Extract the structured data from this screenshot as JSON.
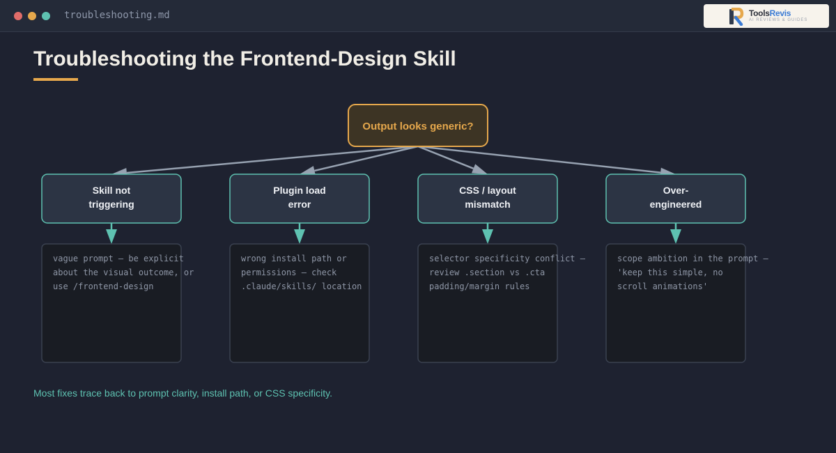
{
  "window": {
    "filename": "troubleshooting.md"
  },
  "logo": {
    "name_part1": "Tools",
    "name_part2": "Revis",
    "tagline": "AI REVIEWS & GUIDES"
  },
  "page": {
    "title": "Troubleshooting the Frontend-Design Skill",
    "caption": "Most fixes trace back to prompt clarity, install path, or CSS specificity."
  },
  "diagram": {
    "root": "Output looks generic?",
    "branches": [
      {
        "id": "skill-not-triggering",
        "label_lines": [
          "Skill not",
          "triggering"
        ],
        "detail_lines": [
          "vague prompt — be explicit",
          "about the visual outcome, or",
          "use /frontend-design"
        ]
      },
      {
        "id": "plugin-load-error",
        "label_lines": [
          "Plugin load",
          "error"
        ],
        "detail_lines": [
          "wrong install path or",
          "permissions — check",
          ".claude/skills/ location"
        ]
      },
      {
        "id": "css-layout-mismatch",
        "label_lines": [
          "CSS / layout",
          "mismatch"
        ],
        "detail_lines": [
          "selector specificity conflict —",
          "review .section vs .cta",
          "padding/margin rules"
        ]
      },
      {
        "id": "over-engineered",
        "label_lines": [
          "Over-",
          "engineered"
        ],
        "detail_lines": [
          "scope ambition in the prompt —",
          "'keep this simple, no",
          "scroll animations'"
        ]
      }
    ]
  },
  "colors": {
    "background": "#1e2230",
    "accent_orange": "#e6a84c",
    "accent_teal": "#5ec2b1",
    "connector_gray": "#97a2b1"
  }
}
